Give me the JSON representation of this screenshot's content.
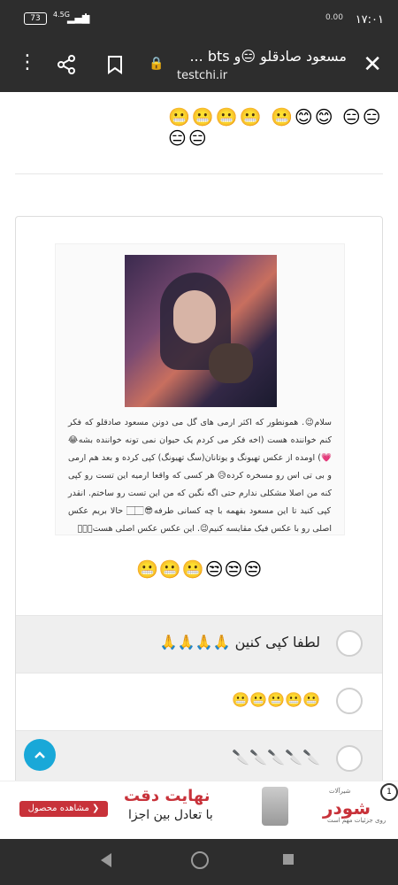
{
  "status_bar": {
    "time": "۱۷:۰۱",
    "battery": "73",
    "network": "4.5G",
    "speed": "0.00"
  },
  "toolbar": {
    "title": "مسعود صادقلو 😑و bts ...",
    "url": "testchi.ir"
  },
  "content": {
    "top_emojis": "😬😬😬😬 😬😊😊 😑😑😑😑",
    "body_text": "سلام😉. همونطور که اکثر ارمی های گل می دونن مسعود صادقلو که فکر کنم خواننده هست (اخه فکر می کردم یک حیوان نمی تونه خواننده بشه😂💗) اومده از عکس تهیونگ و یوتانان(سگ تهیونگ) کپی کرده و بعد هم ارمی و بی تی اس رو مسخره کرده😥 هر کسی که واقعا ارمیه این تست رو کپی کنه من اصلا مشکلی ندارم حتی اگه نگین که من این تست رو ساختم. انقدر کپی کنید تا این مسعود بفهمه با چه کسانی طرفه😎🏻🏻 حالا بریم عکس اصلی رو با عکس فیک مقایسه کنیم😉. این عکس عکس اصلی هست🏻🏻🏻",
    "bottom_emojis": "😬😬😬😒😒😒"
  },
  "options": [
    {
      "label": "لطفا کپی کنین 🙏🙏🙏🙏"
    },
    {
      "label": "😬😬😬😬😬"
    },
    {
      "label": "🔪🔪🔪🔪🔪"
    }
  ],
  "ad": {
    "headline": "نهایت دقت",
    "subline": "با تعادل بین اجزا",
    "cta": "مشاهده محصول ❯",
    "brand": "شودر",
    "brand_top": "شیرآلات",
    "brand_sub": "روی جزئیات مهم است",
    "badge": "1"
  },
  "colors": {
    "bar": "#2d2d2d",
    "accent": "#19a8d8",
    "ad_red": "#c8323a"
  }
}
